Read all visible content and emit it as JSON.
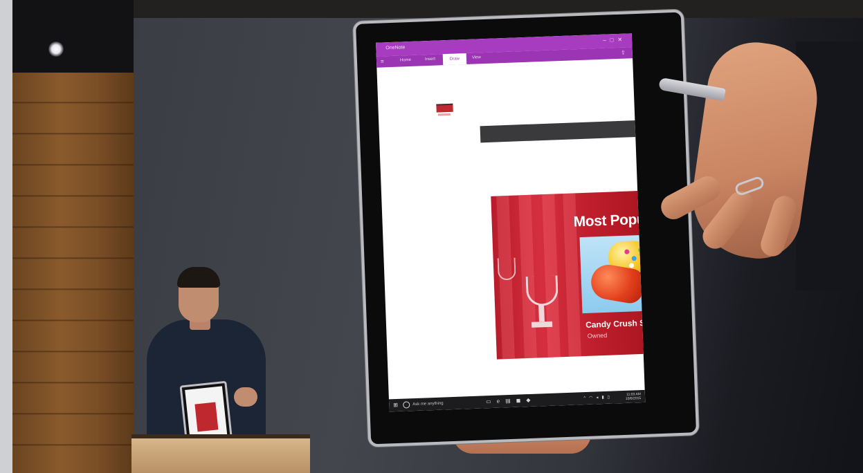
{
  "app": {
    "window_title": "OneNote",
    "ribbon_tabs": [
      "Home",
      "Insert",
      "Draw",
      "View"
    ],
    "active_tab_index": 2,
    "window_buttons": [
      "–",
      "□",
      "✕"
    ]
  },
  "promo": {
    "heading": "Most Popu",
    "game_title": "Candy Crush Sag",
    "game_subtitle": "Owned"
  },
  "taskbar": {
    "search_placeholder": "Ask me anything",
    "clock_time": "11:03 AM",
    "clock_date": "10/6/2015"
  },
  "colors": {
    "onenote_purple": "#a83cc0",
    "promo_red": "#c01f2d",
    "taskbar": "#1c1c1e"
  }
}
